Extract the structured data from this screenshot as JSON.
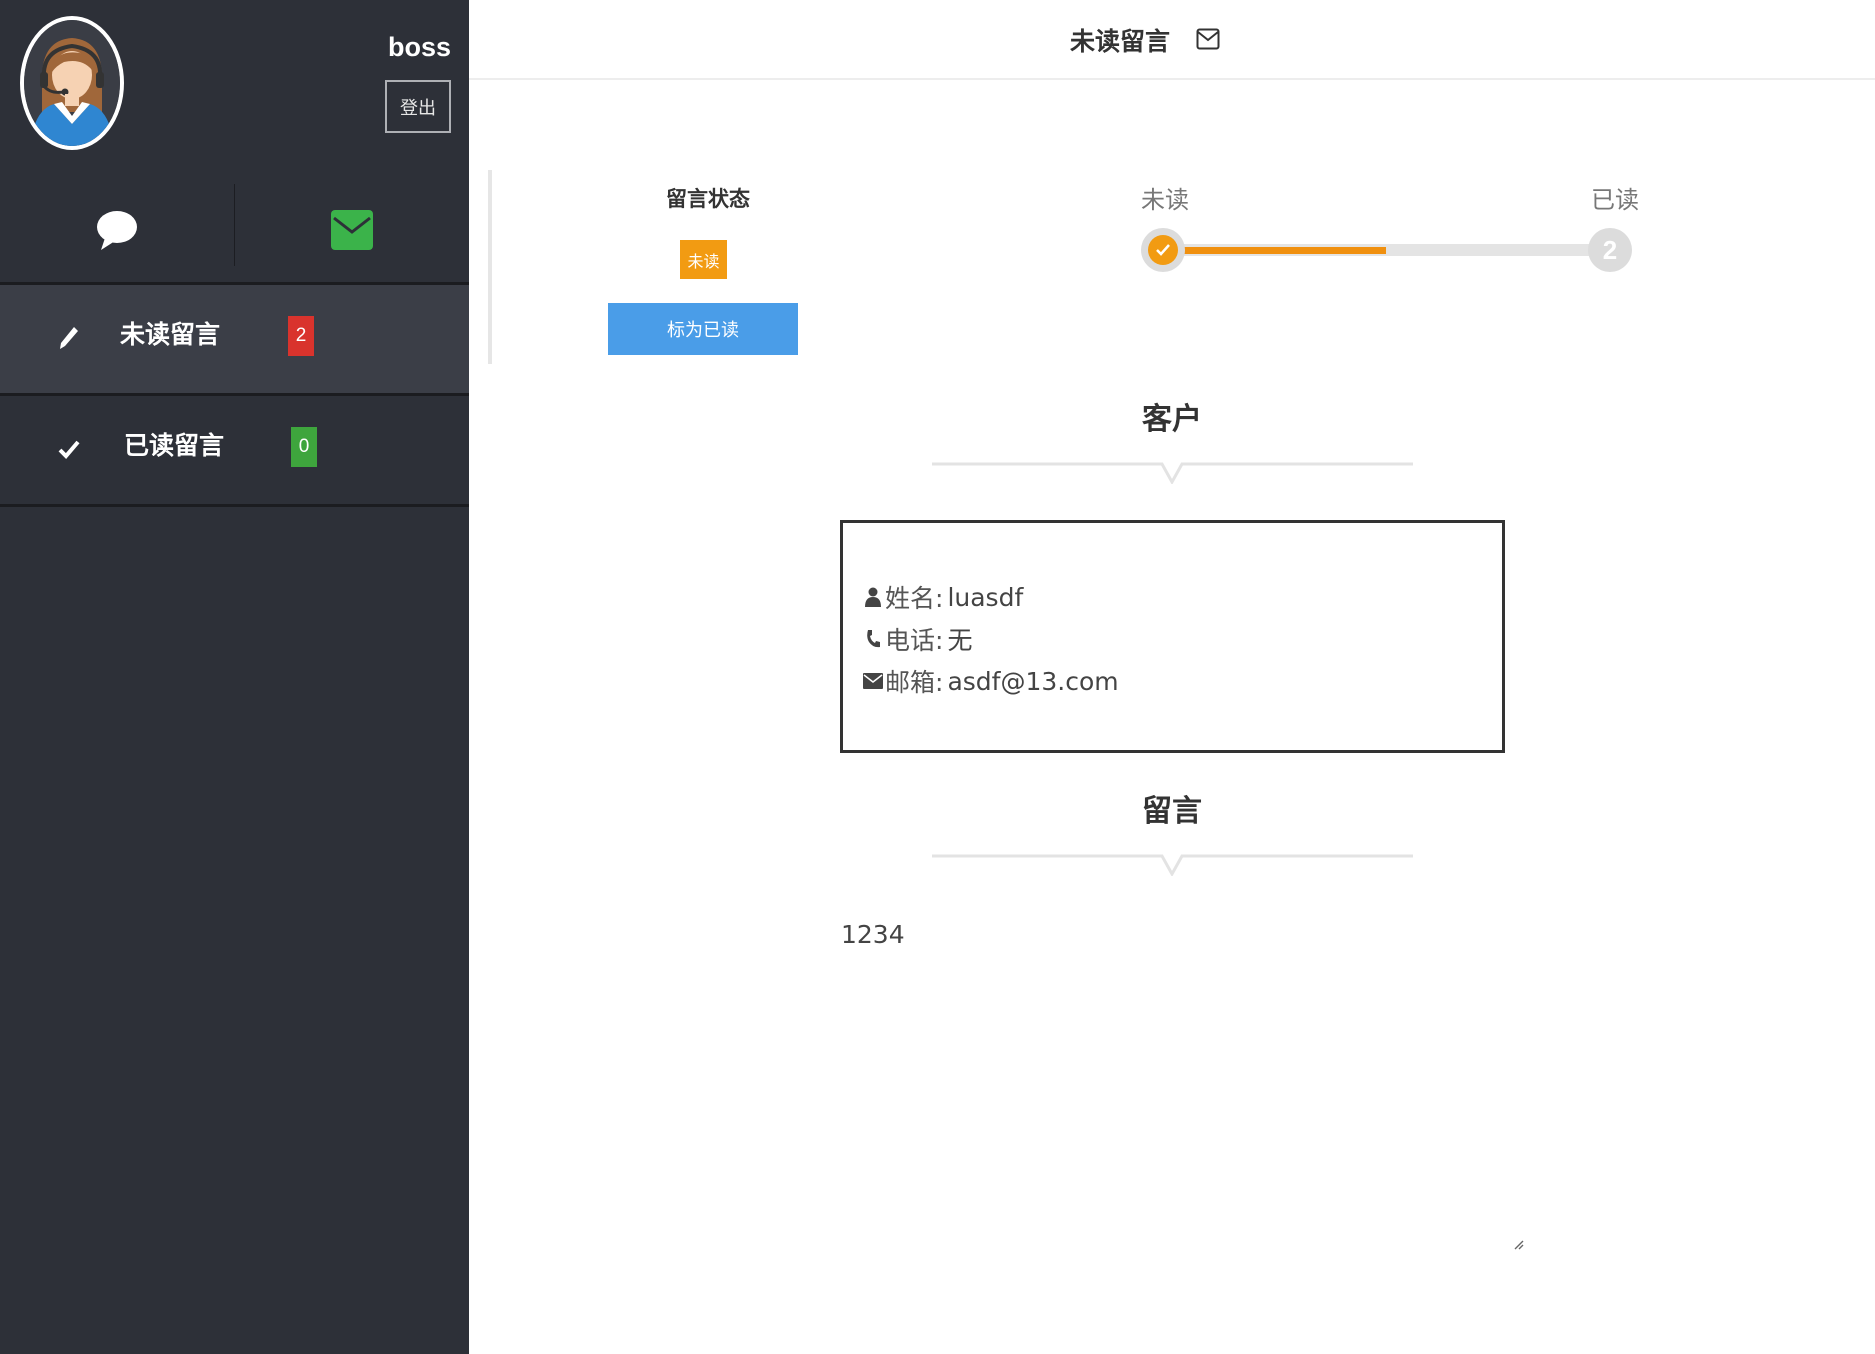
{
  "user": {
    "name": "boss",
    "logout_label": "登出"
  },
  "sidebar": {
    "icons": [
      "chat-icon",
      "envelope-icon"
    ],
    "items": [
      {
        "icon": "pencil-icon",
        "label": "未读留言",
        "count": "2",
        "badge_color": "#d9332d",
        "active": true
      },
      {
        "icon": "check-icon",
        "label": "已读留言",
        "count": "0",
        "badge_color": "#3ea53d",
        "active": false
      }
    ]
  },
  "header": {
    "title": "未读留言",
    "icon": "envelope-outline-icon"
  },
  "status": {
    "label": "留言状态",
    "tag": "未读",
    "tag_color": "#f29b12",
    "mark_read_button": "标为已读",
    "button_color": "#4a9de8"
  },
  "progress": {
    "steps": [
      {
        "label": "未读",
        "done": true
      },
      {
        "label": "已读",
        "number": "2",
        "done": false
      }
    ],
    "progress_fraction": 0.5,
    "accent": "#f0900f"
  },
  "customer": {
    "section_title": "客户",
    "name_label": "姓名:",
    "name": "luasdf",
    "phone_label": "电话:",
    "phone": "无",
    "email_label": "邮箱:",
    "email": "asdf@13.com"
  },
  "message": {
    "section_title": "留言",
    "content": "1234"
  }
}
